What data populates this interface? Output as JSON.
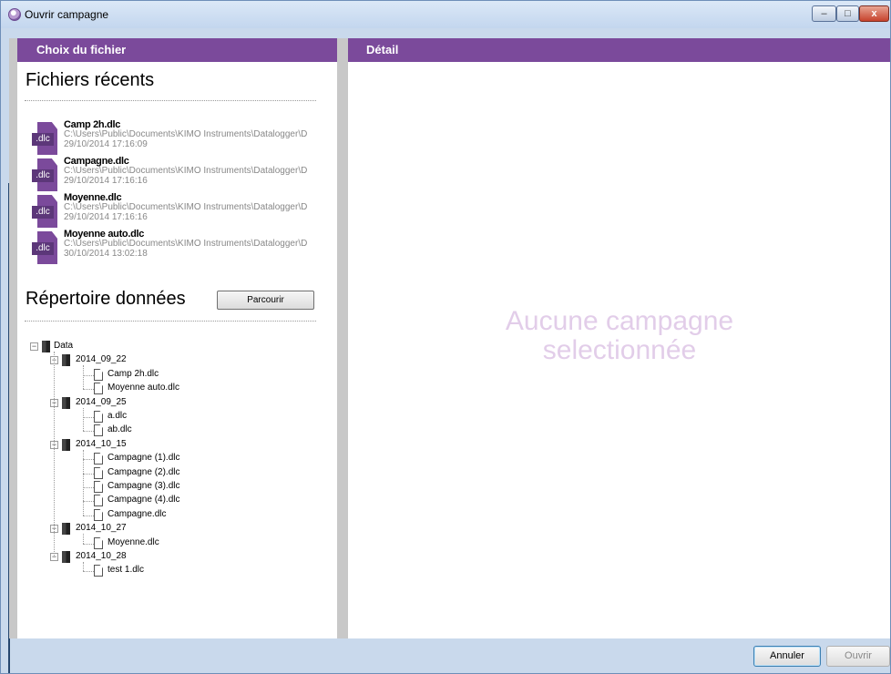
{
  "window": {
    "title": "Ouvrir campagne"
  },
  "left_panel": {
    "header": "Choix du fichier",
    "recent_title": "Fichiers récents",
    "recent_files": [
      {
        "name": "Camp 2h.dlc",
        "path": "C:\\Users\\Public\\Documents\\KIMO Instruments\\Datalogger\\D",
        "date": "29/10/2014 17:16:09",
        "icon_label": ".dlc"
      },
      {
        "name": "Campagne.dlc",
        "path": "C:\\Users\\Public\\Documents\\KIMO Instruments\\Datalogger\\D",
        "date": "29/10/2014 17:16:16",
        "icon_label": ".dlc"
      },
      {
        "name": "Moyenne.dlc",
        "path": "C:\\Users\\Public\\Documents\\KIMO Instruments\\Datalogger\\D",
        "date": "29/10/2014 17:16:16",
        "icon_label": ".dlc"
      },
      {
        "name": "Moyenne auto.dlc",
        "path": "C:\\Users\\Public\\Documents\\KIMO Instruments\\Datalogger\\D",
        "date": "30/10/2014 13:02:18",
        "icon_label": ".dlc"
      }
    ],
    "data_dir_title": "Répertoire données",
    "browse_button": "Parcourir",
    "tree": {
      "root": "Data",
      "folders": [
        {
          "name": "2014_09_22",
          "files": [
            "Camp 2h.dlc",
            "Moyenne auto.dlc"
          ]
        },
        {
          "name": "2014_09_25",
          "files": [
            "a.dlc",
            "ab.dlc"
          ]
        },
        {
          "name": "2014_10_15",
          "files": [
            "Campagne (1).dlc",
            "Campagne (2).dlc",
            "Campagne (3).dlc",
            "Campagne (4).dlc",
            "Campagne.dlc"
          ]
        },
        {
          "name": "2014_10_27",
          "files": [
            "Moyenne.dlc"
          ]
        },
        {
          "name": "2014_10_28",
          "files": [
            "test 1.dlc"
          ]
        }
      ]
    }
  },
  "right_panel": {
    "header": "Détail",
    "placeholder_line1": "Aucune campagne",
    "placeholder_line2": "selectionnée"
  },
  "footer": {
    "cancel": "Annuler",
    "open": "Ouvrir"
  },
  "colors": {
    "accent": "#7b4a9b",
    "placeholder": "#e2cde9"
  }
}
